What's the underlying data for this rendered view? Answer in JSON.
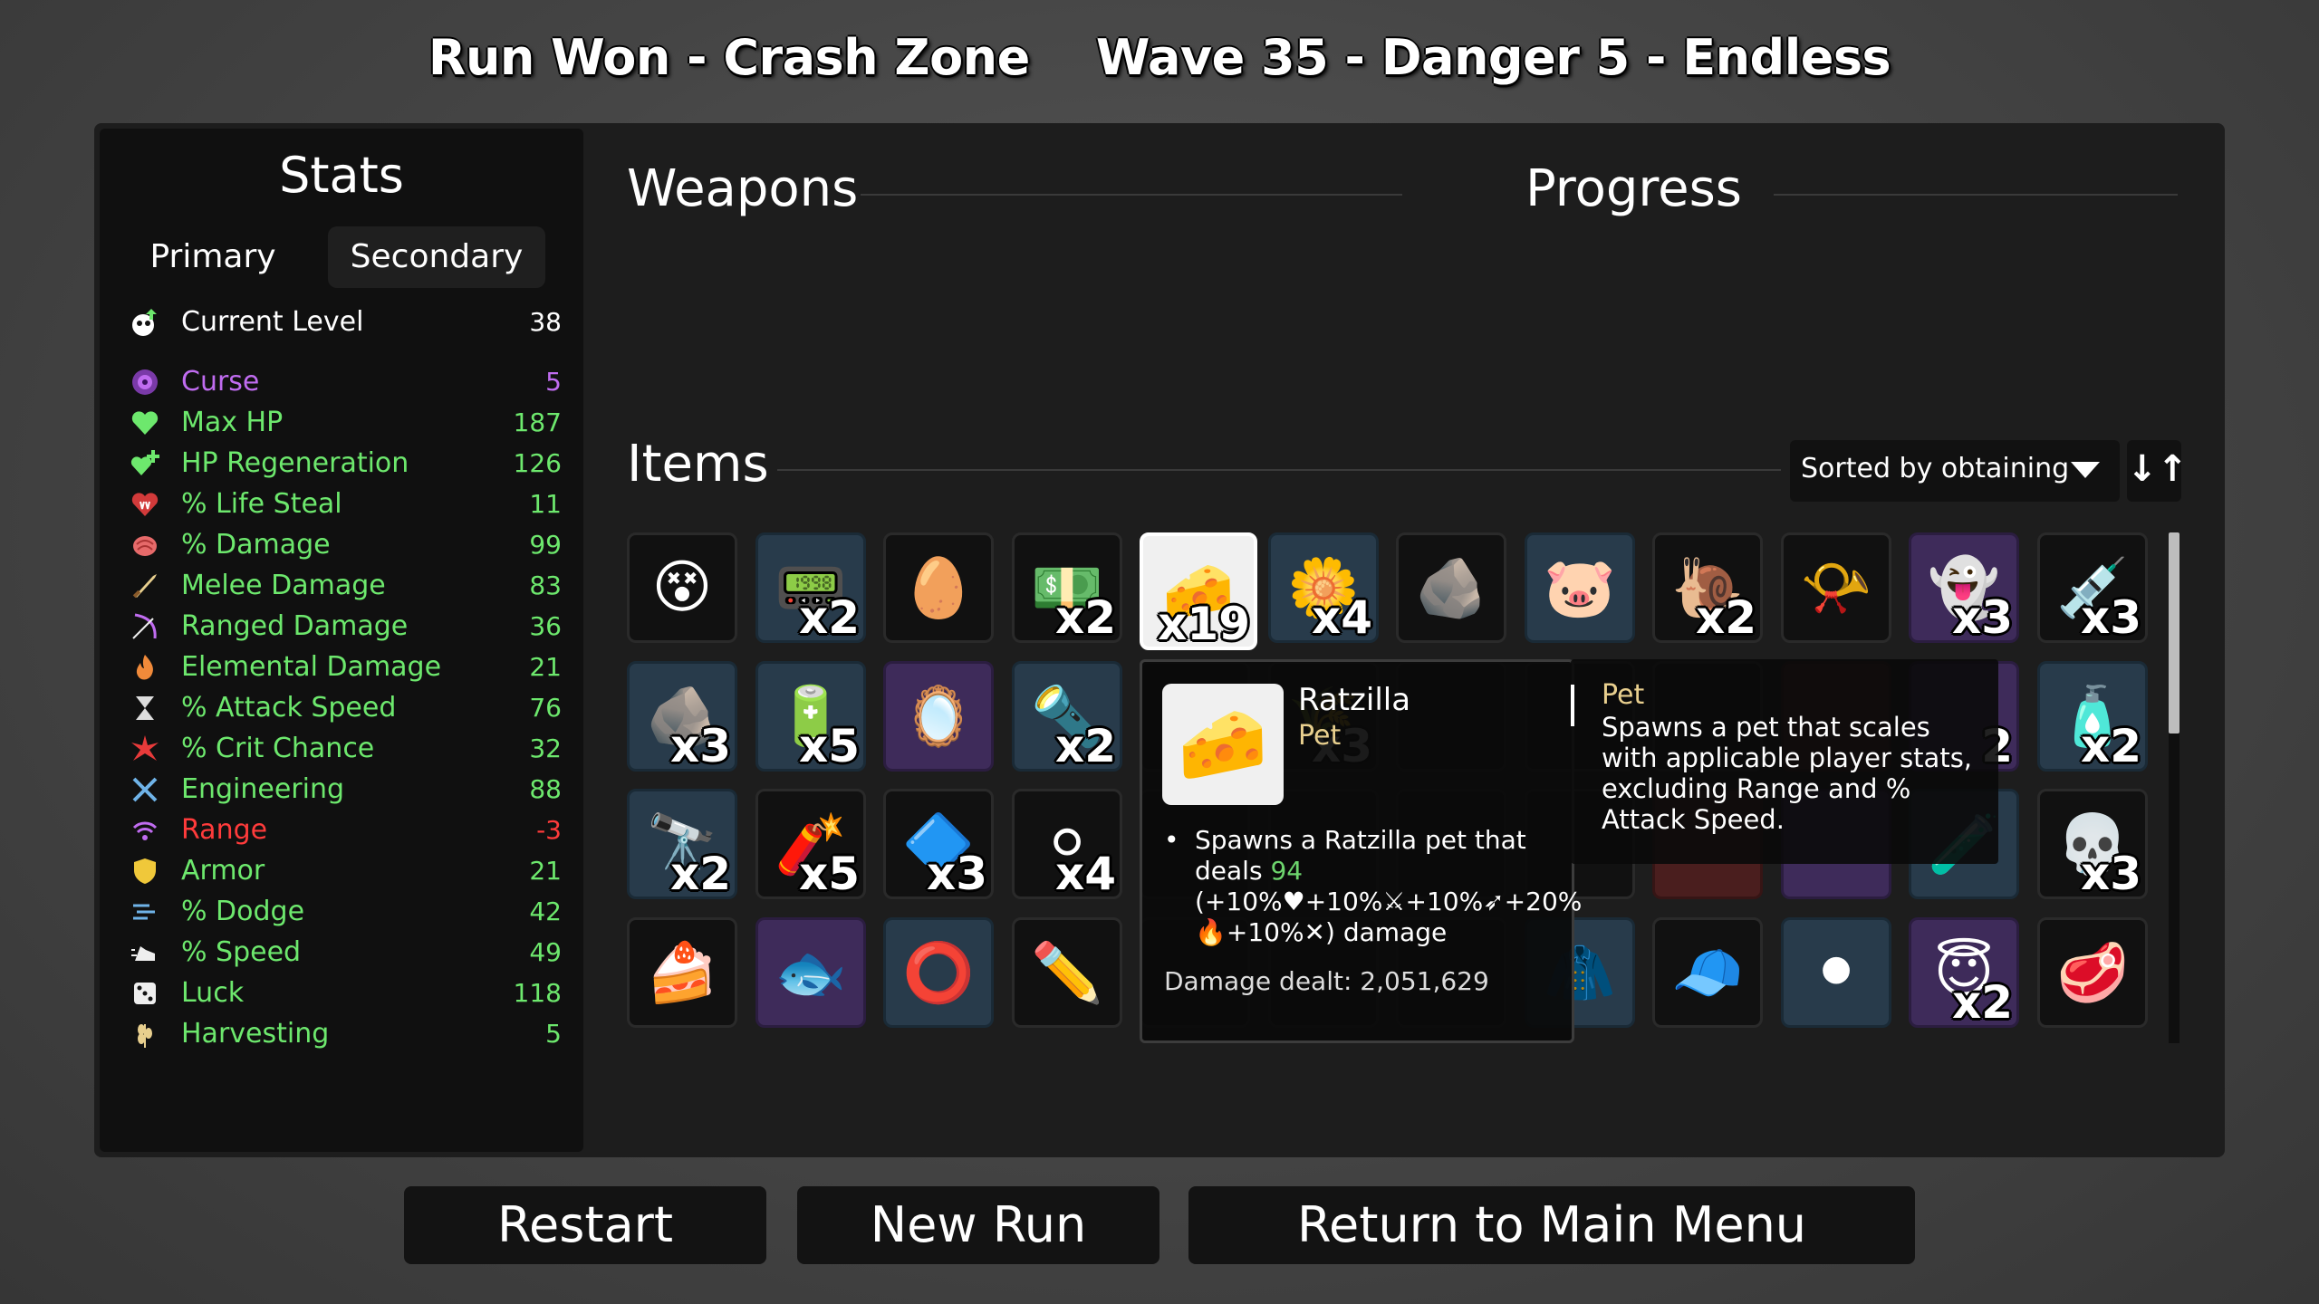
{
  "header": {
    "left": "Run Won - Crash Zone",
    "right": "Wave 35 - Danger 5 - Endless"
  },
  "stats": {
    "title": "Stats",
    "tabs": {
      "primary": "Primary",
      "secondary": "Secondary",
      "selected": "Secondary"
    },
    "level": {
      "icon": "level-up-icon",
      "label": "Current Level",
      "value": "38",
      "color": "#ffffff"
    },
    "rows": [
      {
        "icon": "curse-icon",
        "label": "Curse",
        "value": "5",
        "color": "#c06cf0"
      },
      {
        "icon": "heart-icon",
        "label": "Max HP",
        "value": "187",
        "color": "#6de86d"
      },
      {
        "icon": "hp-regen-icon",
        "label": "HP Regeneration",
        "value": "126",
        "color": "#6de86d"
      },
      {
        "icon": "life-steal-icon",
        "label": "% Life Steal",
        "value": "11",
        "color": "#6de86d"
      },
      {
        "icon": "damage-icon",
        "label": "% Damage",
        "value": "99",
        "color": "#6de86d"
      },
      {
        "icon": "melee-icon",
        "label": "Melee Damage",
        "value": "83",
        "color": "#6de86d"
      },
      {
        "icon": "ranged-icon",
        "label": "Ranged Damage",
        "value": "36",
        "color": "#6de86d"
      },
      {
        "icon": "elemental-icon",
        "label": "Elemental Damage",
        "value": "21",
        "color": "#6de86d"
      },
      {
        "icon": "attack-speed-icon",
        "label": "% Attack Speed",
        "value": "76",
        "color": "#6de86d"
      },
      {
        "icon": "crit-icon",
        "label": "% Crit Chance",
        "value": "32",
        "color": "#6de86d"
      },
      {
        "icon": "engineering-icon",
        "label": "Engineering",
        "value": "88",
        "color": "#6de86d"
      },
      {
        "icon": "range-icon",
        "label": "Range",
        "value": "-3",
        "color": "#ff3b3b"
      },
      {
        "icon": "armor-icon",
        "label": "Armor",
        "value": "21",
        "color": "#6de86d"
      },
      {
        "icon": "dodge-icon",
        "label": "% Dodge",
        "value": "42",
        "color": "#6de86d"
      },
      {
        "icon": "speed-icon",
        "label": "% Speed",
        "value": "49",
        "color": "#6de86d"
      },
      {
        "icon": "luck-icon",
        "label": "Luck",
        "value": "118",
        "color": "#6de86d"
      },
      {
        "icon": "harvesting-icon",
        "label": "Harvesting",
        "value": "5",
        "color": "#6de86d"
      }
    ]
  },
  "weapons": {
    "title": "Weapons"
  },
  "progress": {
    "title": "Progress"
  },
  "items": {
    "title": "Items",
    "sort_label": "Sorted by obtaining",
    "sort_toggle": "↓↑",
    "grid": [
      [
        {
          "icon": "pirate-face-icon",
          "qty": "",
          "tier": "t0",
          "glyph": "😵"
        },
        {
          "icon": "detonator-icon",
          "qty": "x2",
          "tier": "t1",
          "glyph": "📟"
        },
        {
          "icon": "alien-egg-icon",
          "qty": "",
          "tier": "t0",
          "glyph": "🥚"
        },
        {
          "icon": "cash-bill-icon",
          "qty": "x2",
          "tier": "t0",
          "glyph": "💵"
        },
        {
          "icon": "cheese-icon",
          "qty": "x19",
          "tier": "sel",
          "glyph": "🧀"
        },
        {
          "icon": "flower-icon",
          "qty": "x4",
          "tier": "t1",
          "glyph": "🌼"
        },
        {
          "icon": "rock-icon",
          "qty": "",
          "tier": "t0",
          "glyph": "🪨"
        },
        {
          "icon": "piggy-bank-icon",
          "qty": "",
          "tier": "t1",
          "glyph": "🐷"
        },
        {
          "icon": "snail-icon",
          "qty": "x2",
          "tier": "t0",
          "glyph": "🐌"
        },
        {
          "icon": "whistle-icon",
          "qty": "",
          "tier": "t0",
          "glyph": "📯"
        },
        {
          "icon": "blue-ghost-icon",
          "qty": "x3",
          "tier": "t2",
          "glyph": "👻"
        },
        {
          "icon": "syringe-icon",
          "qty": "x3",
          "tier": "t0",
          "glyph": "💉"
        }
      ],
      [
        {
          "icon": "ore-rock-icon",
          "qty": "x3",
          "tier": "t1",
          "glyph": "🪨"
        },
        {
          "icon": "coil-icon",
          "qty": "x5",
          "tier": "t1",
          "glyph": "🔋"
        },
        {
          "icon": "mirror-icon",
          "qty": "",
          "tier": "t2",
          "glyph": "🪞"
        },
        {
          "icon": "flashlight-icon",
          "qty": "x2",
          "tier": "t1",
          "glyph": "🔦"
        },
        {
          "icon": "hidden-slot-icon",
          "qty": "",
          "tier": "t0",
          "glyph": ""
        },
        {
          "icon": "wheat-icon",
          "qty": "x3",
          "tier": "t0",
          "glyph": "🌾"
        },
        {
          "icon": "hidden-slot-icon",
          "qty": "",
          "tier": "t0",
          "glyph": ""
        },
        {
          "icon": "hidden-slot-icon",
          "qty": "",
          "tier": "t0",
          "glyph": ""
        },
        {
          "icon": "hidden-slot-icon",
          "qty": "",
          "tier": "t0",
          "glyph": ""
        },
        {
          "icon": "hidden-slot-icon",
          "qty": "",
          "tier": "t3",
          "glyph": ""
        },
        {
          "icon": "hidden-slot-icon",
          "qty": "2",
          "tier": "t2",
          "glyph": ""
        },
        {
          "icon": "ketchup-bottle-icon",
          "qty": "x2",
          "tier": "t1",
          "glyph": "🧴"
        }
      ],
      [
        {
          "icon": "spyglass-icon",
          "qty": "x2",
          "tier": "t1",
          "glyph": "🔭"
        },
        {
          "icon": "dynamite-icon",
          "qty": "x5",
          "tier": "t0",
          "glyph": "🧨"
        },
        {
          "icon": "metal-plate-icon",
          "qty": "x3",
          "tier": "t0",
          "glyph": "🔷"
        },
        {
          "icon": "pearl-icon",
          "qty": "x4",
          "tier": "t0",
          "glyph": "⚪"
        },
        {
          "icon": "hidden-slot-icon",
          "qty": "",
          "tier": "t0",
          "glyph": ""
        },
        {
          "icon": "hidden-slot-icon",
          "qty": "",
          "tier": "t0",
          "glyph": ""
        },
        {
          "icon": "hidden-slot-icon",
          "qty": "",
          "tier": "t0",
          "glyph": ""
        },
        {
          "icon": "hidden-slot-icon",
          "qty": "",
          "tier": "t0",
          "glyph": ""
        },
        {
          "icon": "hidden-slot-icon",
          "qty": "",
          "tier": "t3",
          "glyph": ""
        },
        {
          "icon": "hidden-slot-icon",
          "qty": "",
          "tier": "t2",
          "glyph": ""
        },
        {
          "icon": "potion-flask-icon",
          "qty": "",
          "tier": "t1",
          "glyph": "🧪"
        },
        {
          "icon": "horned-skull-icon",
          "qty": "x3",
          "tier": "t0",
          "glyph": "💀"
        }
      ],
      [
        {
          "icon": "cake-slice-icon",
          "qty": "",
          "tier": "t0",
          "glyph": "🍰"
        },
        {
          "icon": "goldfish-icon",
          "qty": "",
          "tier": "t2",
          "glyph": "🐟"
        },
        {
          "icon": "lifebuoy-icon",
          "qty": "",
          "tier": "t1",
          "glyph": "⭕"
        },
        {
          "icon": "pencil-icon",
          "qty": "",
          "tier": "t0",
          "glyph": "✏️"
        },
        {
          "icon": "hidden-slot-icon",
          "qty": "",
          "tier": "t0",
          "glyph": ""
        },
        {
          "icon": "hidden-slot-icon",
          "qty": "",
          "tier": "t0",
          "glyph": ""
        },
        {
          "icon": "hidden-slot-icon",
          "qty": "",
          "tier": "t0",
          "glyph": ""
        },
        {
          "icon": "scarecrow-icon",
          "qty": "",
          "tier": "t1",
          "glyph": "🧥"
        },
        {
          "icon": "beanie-icon",
          "qty": "",
          "tier": "t0",
          "glyph": "🧢"
        },
        {
          "icon": "spotted-blob-icon",
          "qty": "",
          "tier": "t1",
          "glyph": "⚫"
        },
        {
          "icon": "angel-robot-icon",
          "qty": "x2",
          "tier": "t2",
          "glyph": "😇"
        },
        {
          "icon": "steak-icon",
          "qty": "",
          "tier": "t0",
          "glyph": "🥩"
        }
      ]
    ]
  },
  "tooltip": {
    "icon": "cheese-icon",
    "name": "Ratzilla",
    "type": "Pet",
    "bullet": "•",
    "desc_pre": "Spawns a Ratzilla pet that deals",
    "desc_value": "94",
    "desc_scaling": "(+10%♥+10%⚔+10%➶+20%🔥+10%✕) damage",
    "damage_dealt": "Damage dealt: 2,051,629"
  },
  "pet_info": {
    "title": "Pet",
    "body": "Spawns a pet that scales with applicable player stats, excluding Range and % Attack Speed."
  },
  "buttons": {
    "restart": "Restart",
    "new_run": "New Run",
    "main_menu": "Return to Main Menu"
  }
}
